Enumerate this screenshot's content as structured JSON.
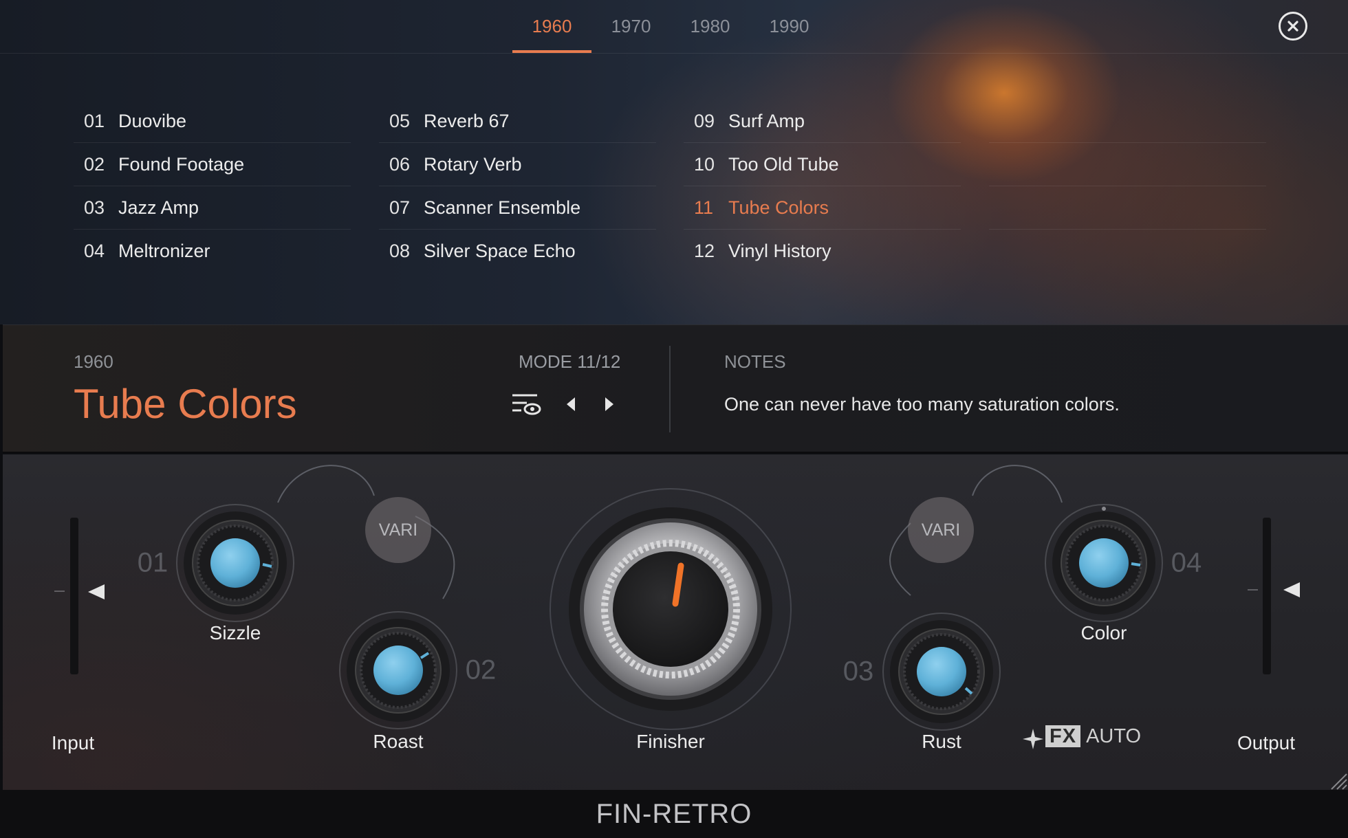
{
  "tabs": [
    "1960",
    "1970",
    "1980",
    "1990"
  ],
  "active_tab": "1960",
  "presets": {
    "col1": [
      {
        "num": "01",
        "name": "Duovibe"
      },
      {
        "num": "02",
        "name": "Found Footage"
      },
      {
        "num": "03",
        "name": "Jazz Amp"
      },
      {
        "num": "04",
        "name": "Meltronizer"
      }
    ],
    "col2": [
      {
        "num": "05",
        "name": "Reverb 67"
      },
      {
        "num": "06",
        "name": "Rotary Verb"
      },
      {
        "num": "07",
        "name": "Scanner Ensemble"
      },
      {
        "num": "08",
        "name": "Silver Space Echo"
      }
    ],
    "col3": [
      {
        "num": "09",
        "name": "Surf Amp"
      },
      {
        "num": "10",
        "name": "Too Old Tube"
      },
      {
        "num": "11",
        "name": "Tube Colors"
      },
      {
        "num": "12",
        "name": "Vinyl History"
      }
    ]
  },
  "selected_preset": "11",
  "info": {
    "era": "1960",
    "title": "Tube Colors",
    "mode": "MODE 11/12",
    "notes_label": "NOTES",
    "notes_text": "One can never have too many saturation colors."
  },
  "controls": {
    "input_label": "Input",
    "output_label": "Output",
    "sizzle": {
      "label": "Sizzle",
      "slot": "01"
    },
    "roast": {
      "label": "Roast",
      "slot": "02"
    },
    "rust": {
      "label": "Rust",
      "slot": "03"
    },
    "color": {
      "label": "Color",
      "slot": "04"
    },
    "finisher": {
      "label": "Finisher"
    },
    "vari_left": "VARI",
    "vari_right": "VARI",
    "fx_badge": "FX",
    "auto_label": "AUTO"
  },
  "colors": {
    "accent": "#e87c4f",
    "knob_blue": "#5fb1d8",
    "finisher_pointer": "#f07328"
  },
  "icons": {
    "close": "close-icon",
    "mode_list": "list-eye-icon",
    "prev": "caret-left-icon",
    "next": "caret-right-icon",
    "sparkle": "sparkle-icon"
  },
  "footer": {
    "brand": "FIN-RETRO"
  }
}
